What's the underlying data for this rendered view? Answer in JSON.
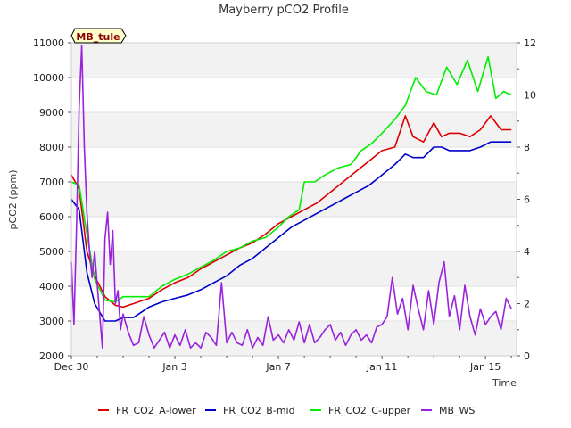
{
  "chart_data": {
    "type": "line",
    "title": "Mayberry pCO2 Profile",
    "xlabel": "Time",
    "ylabel": "pCO2 (ppm)",
    "ylabel_right": "",
    "badge": "MB_tule",
    "ylim": [
      2000,
      11000
    ],
    "ylim_right": [
      0,
      12
    ],
    "xlim": [
      0,
      17.2
    ],
    "x_ticks": [
      {
        "x": 0,
        "label": "Dec 30"
      },
      {
        "x": 4,
        "label": "Jan 3"
      },
      {
        "x": 8,
        "label": "Jan 7"
      },
      {
        "x": 12,
        "label": "Jan 11"
      },
      {
        "x": 16,
        "label": "Jan 15"
      }
    ],
    "y_ticks": [
      2000,
      3000,
      4000,
      5000,
      6000,
      7000,
      8000,
      9000,
      10000,
      11000
    ],
    "y_ticks_right": [
      0,
      2,
      4,
      6,
      8,
      10,
      12
    ],
    "grid": "horizontal bands",
    "legend_position": "bottom",
    "x_unit": "days since Dec 30",
    "series": [
      {
        "name": "FR_CO2_A-lower",
        "color": "#dd0000",
        "axis": "left",
        "x": [
          0,
          0.3,
          0.6,
          0.9,
          1.3,
          1.7,
          2.0,
          2.4,
          3.0,
          3.5,
          4.0,
          4.5,
          5.0,
          5.5,
          6.0,
          6.5,
          7.0,
          7.5,
          8.0,
          8.5,
          9.0,
          9.5,
          10.0,
          10.5,
          11.0,
          11.5,
          12.0,
          12.5,
          12.9,
          13.2,
          13.6,
          14.0,
          14.3,
          14.6,
          15.0,
          15.4,
          15.8,
          16.2,
          16.6,
          17.0
        ],
        "y": [
          7200,
          6800,
          5000,
          4300,
          3700,
          3450,
          3400,
          3500,
          3650,
          3900,
          4100,
          4250,
          4500,
          4700,
          4900,
          5100,
          5250,
          5500,
          5800,
          6000,
          6200,
          6400,
          6700,
          7000,
          7300,
          7600,
          7900,
          8000,
          8900,
          8300,
          8150,
          8700,
          8300,
          8400,
          8400,
          8300,
          8500,
          8900,
          8500,
          8500
        ]
      },
      {
        "name": "FR_CO2_B-mid",
        "color": "#0000cc",
        "axis": "left",
        "x": [
          0,
          0.3,
          0.6,
          0.9,
          1.3,
          1.7,
          2.0,
          2.4,
          3.0,
          3.5,
          4.0,
          4.5,
          5.0,
          5.5,
          6.0,
          6.5,
          7.0,
          7.5,
          8.0,
          8.5,
          9.0,
          9.5,
          10.0,
          10.5,
          11.0,
          11.5,
          12.0,
          12.5,
          12.9,
          13.2,
          13.6,
          14.0,
          14.3,
          14.6,
          15.0,
          15.4,
          15.8,
          16.2,
          16.6,
          17.0
        ],
        "y": [
          6500,
          6200,
          4400,
          3500,
          3000,
          3000,
          3100,
          3100,
          3400,
          3550,
          3650,
          3750,
          3900,
          4100,
          4300,
          4600,
          4800,
          5100,
          5400,
          5700,
          5900,
          6100,
          6300,
          6500,
          6700,
          6900,
          7200,
          7500,
          7800,
          7700,
          7700,
          8000,
          8000,
          7900,
          7900,
          7900,
          8000,
          8150,
          8150,
          8150
        ]
      },
      {
        "name": "FR_CO2_C-upper",
        "color": "#00ee00",
        "axis": "left",
        "x": [
          0,
          0.3,
          0.6,
          0.9,
          1.3,
          1.7,
          2.0,
          2.4,
          3.0,
          3.5,
          4.0,
          4.5,
          5.0,
          5.5,
          6.0,
          6.5,
          7.0,
          7.5,
          8.0,
          8.4,
          8.8,
          9.0,
          9.4,
          9.8,
          10.3,
          10.8,
          11.2,
          11.6,
          12.0,
          12.5,
          12.9,
          13.3,
          13.7,
          14.1,
          14.5,
          14.9,
          15.3,
          15.7,
          16.1,
          16.4,
          16.7,
          17.0
        ],
        "y": [
          7000,
          6900,
          5500,
          4200,
          3600,
          3550,
          3700,
          3700,
          3700,
          4000,
          4200,
          4350,
          4550,
          4750,
          5000,
          5100,
          5300,
          5400,
          5700,
          6000,
          6200,
          7000,
          7000,
          7200,
          7400,
          7500,
          7900,
          8100,
          8400,
          8800,
          9200,
          10000,
          9600,
          9500,
          10300,
          9800,
          10500,
          9600,
          10600,
          9400,
          9600,
          9500
        ]
      },
      {
        "name": "MB_WS",
        "color": "#9a22dd",
        "axis": "right",
        "x": [
          0,
          0.1,
          0.2,
          0.3,
          0.4,
          0.5,
          0.6,
          0.7,
          0.8,
          0.9,
          1.0,
          1.1,
          1.2,
          1.3,
          1.4,
          1.5,
          1.6,
          1.7,
          1.8,
          1.9,
          2.0,
          2.2,
          2.4,
          2.6,
          2.8,
          3.0,
          3.2,
          3.4,
          3.6,
          3.8,
          4.0,
          4.2,
          4.4,
          4.6,
          4.8,
          5.0,
          5.2,
          5.4,
          5.6,
          5.8,
          6.0,
          6.2,
          6.4,
          6.6,
          6.8,
          7.0,
          7.2,
          7.4,
          7.6,
          7.8,
          8.0,
          8.2,
          8.4,
          8.6,
          8.8,
          9.0,
          9.2,
          9.4,
          9.6,
          9.8,
          10.0,
          10.2,
          10.4,
          10.6,
          10.8,
          11.0,
          11.2,
          11.4,
          11.6,
          11.8,
          12.0,
          12.2,
          12.4,
          12.6,
          12.8,
          13.0,
          13.2,
          13.4,
          13.6,
          13.8,
          14.0,
          14.2,
          14.4,
          14.6,
          14.8,
          15.0,
          15.2,
          15.4,
          15.6,
          15.8,
          16.0,
          16.2,
          16.4,
          16.6,
          16.8,
          17.0
        ],
        "y": [
          3.6,
          1.2,
          5.0,
          9.5,
          11.9,
          8.0,
          5.5,
          4.0,
          3.0,
          4.0,
          2.7,
          1.5,
          0.3,
          4.5,
          5.5,
          3.5,
          4.8,
          2.0,
          2.5,
          1.0,
          1.6,
          0.9,
          0.4,
          0.5,
          1.5,
          0.8,
          0.3,
          0.6,
          0.9,
          0.3,
          0.8,
          0.4,
          1.0,
          0.3,
          0.5,
          0.3,
          0.9,
          0.7,
          0.4,
          2.8,
          0.5,
          0.9,
          0.5,
          0.4,
          1.0,
          0.3,
          0.7,
          0.4,
          1.5,
          0.6,
          0.8,
          0.5,
          1.0,
          0.6,
          1.3,
          0.5,
          1.2,
          0.5,
          0.7,
          1.0,
          1.2,
          0.6,
          0.9,
          0.4,
          0.8,
          1.0,
          0.6,
          0.8,
          0.5,
          1.1,
          1.2,
          1.5,
          3.0,
          1.6,
          2.2,
          1.0,
          2.7,
          1.8,
          1.0,
          2.5,
          1.2,
          2.8,
          3.6,
          1.5,
          2.3,
          1.0,
          2.7,
          1.5,
          0.8,
          1.8,
          1.2,
          1.5,
          1.7,
          1.0,
          2.2,
          1.8
        ]
      }
    ]
  }
}
